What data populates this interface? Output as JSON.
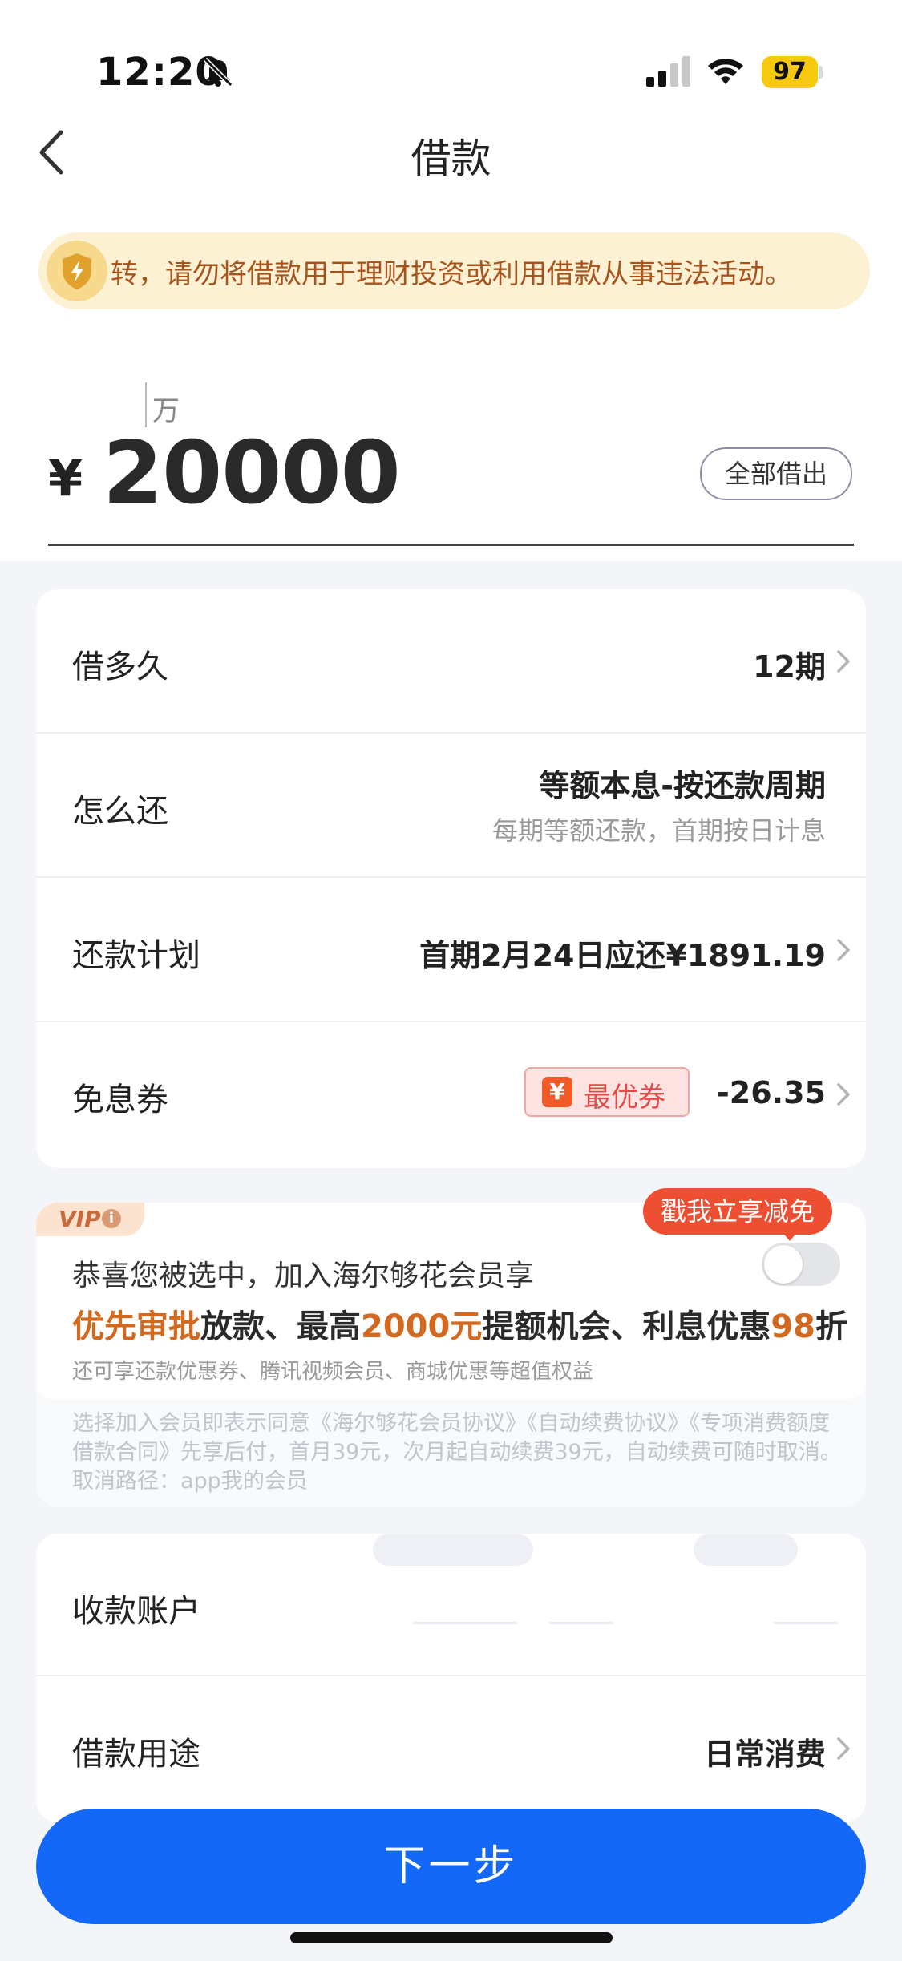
{
  "status_bar": {
    "time": "12:20",
    "battery": "97",
    "icons": [
      "bell-mute-icon",
      "signal-icon",
      "wifi-icon",
      "battery-icon"
    ]
  },
  "nav": {
    "title": "借款"
  },
  "notice": {
    "text": "转，请勿将借款用于理财投资或利用借款从事违法活动。"
  },
  "amount": {
    "unit_hint": "万",
    "currency": "¥",
    "value": "20000",
    "borrow_all_label": "全部借出"
  },
  "loan_rows": [
    {
      "label": "借多久",
      "value": "12期"
    },
    {
      "label": "怎么还",
      "value": "等额本息-按还款周期",
      "sub": "每期等额还款，首期按日计息"
    },
    {
      "label": "还款计划",
      "value": "首期2月24日应还¥1891.19"
    },
    {
      "label": "免息券",
      "coupon_tag": "最优券",
      "coupon_symbol": "¥",
      "value": "-26.35"
    }
  ],
  "vip": {
    "badge": "VIP",
    "bubble": "戳我立享减免",
    "line1": "恭喜您被选中，加入海尔够花会员享",
    "line2_parts": [
      "优先审批",
      "放款、最高",
      "2000元",
      "提额机会、利息优惠",
      "98",
      "折"
    ],
    "line3": "还可享还款优惠券、腾讯视频会员、商城优惠等超值权益",
    "terms": "选择加入会员即表示同意《海尔够花会员协议》《自动续费协议》《专项消费额度借款合同》先享后付，首月39元，次月起自动续费39元，自动续费可随时取消。取消路径：app我的会员",
    "toggle_on": false
  },
  "account_rows": [
    {
      "label": "收款账户"
    },
    {
      "label": "借款用途",
      "value": "日常消费"
    }
  ],
  "next_button": {
    "label": "下一步"
  },
  "colors": {
    "primary": "#1368f7",
    "warning_bg": "#fdf1d4",
    "warning_text": "#a7531d",
    "vip_accent": "#d2691e",
    "bubble": "#ee4e32"
  }
}
